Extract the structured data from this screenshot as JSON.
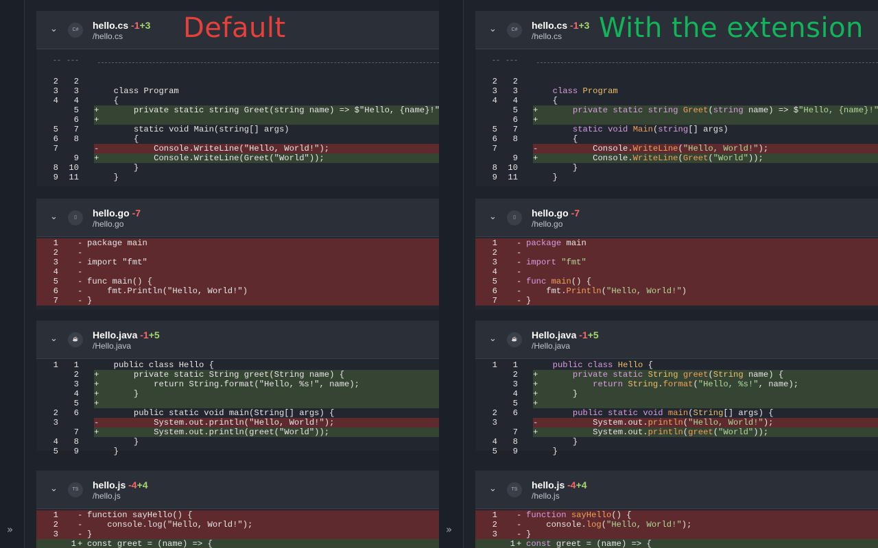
{
  "labels": {
    "left": "Default",
    "right": "With the extension",
    "left_color": "#e5413a",
    "right_color": "#12b35a"
  },
  "icons": {
    "expand": "»",
    "collapse": "⌄"
  },
  "files": [
    {
      "name": "hello.cs",
      "path": "/hello.cs",
      "removed": "-1",
      "added": "+3",
      "icon_text": "C#",
      "hunk_marks": [
        "--",
        "---"
      ],
      "rows": [
        {
          "t": "c",
          "o": "2",
          "n": "2",
          "code": ""
        },
        {
          "t": "c",
          "o": "3",
          "n": "3",
          "code": "  class Program"
        },
        {
          "t": "c",
          "o": "4",
          "n": "4",
          "code": "  {"
        },
        {
          "t": "a",
          "o": "",
          "n": "5",
          "code": "      private static string Greet(string name) => $\"Hello, {name}!\";"
        },
        {
          "t": "a",
          "o": "",
          "n": "6",
          "code": ""
        },
        {
          "t": "c",
          "o": "5",
          "n": "7",
          "code": "      static void Main(string[] args)"
        },
        {
          "t": "c",
          "o": "6",
          "n": "8",
          "code": "      {"
        },
        {
          "t": "d",
          "o": "7",
          "n": "",
          "code": "          Console.WriteLine(\"Hello, World!\");"
        },
        {
          "t": "a",
          "o": "",
          "n": "9",
          "code": "          Console.WriteLine(Greet(\"World\"));"
        },
        {
          "t": "c",
          "o": "8",
          "n": "10",
          "code": "      }"
        },
        {
          "t": "c",
          "o": "9",
          "n": "11",
          "code": "  }"
        }
      ]
    },
    {
      "name": "hello.go",
      "path": "/hello.go",
      "removed": "-7",
      "added": "",
      "icon_text": "▯",
      "rows": [
        {
          "t": "d",
          "o": "1",
          "n": "",
          "code": "package main"
        },
        {
          "t": "d",
          "o": "2",
          "n": "",
          "code": ""
        },
        {
          "t": "d",
          "o": "3",
          "n": "",
          "code": "import \"fmt\""
        },
        {
          "t": "d",
          "o": "4",
          "n": "",
          "code": ""
        },
        {
          "t": "d",
          "o": "5",
          "n": "",
          "code": "func main() {"
        },
        {
          "t": "d",
          "o": "6",
          "n": "",
          "code": "    fmt.Println(\"Hello, World!\")"
        },
        {
          "t": "d",
          "o": "7",
          "n": "",
          "code": "}"
        }
      ]
    },
    {
      "name": "Hello.java",
      "path": "/Hello.java",
      "removed": "-1",
      "added": "+5",
      "icon_text": "☕",
      "rows": [
        {
          "t": "c",
          "o": "1",
          "n": "1",
          "code": "  public class Hello {"
        },
        {
          "t": "a",
          "o": "",
          "n": "2",
          "code": "      private static String greet(String name) {"
        },
        {
          "t": "a",
          "o": "",
          "n": "3",
          "code": "          return String.format(\"Hello, %s!\", name);"
        },
        {
          "t": "a",
          "o": "",
          "n": "4",
          "code": "      }"
        },
        {
          "t": "a",
          "o": "",
          "n": "5",
          "code": ""
        },
        {
          "t": "c",
          "o": "2",
          "n": "6",
          "code": "      public static void main(String[] args) {"
        },
        {
          "t": "d",
          "o": "3",
          "n": "",
          "code": "          System.out.println(\"Hello, World!\");"
        },
        {
          "t": "a",
          "o": "",
          "n": "7",
          "code": "          System.out.println(greet(\"World\"));"
        },
        {
          "t": "c",
          "o": "4",
          "n": "8",
          "code": "      }"
        },
        {
          "t": "c",
          "o": "5",
          "n": "9",
          "code": "  }"
        }
      ]
    },
    {
      "name": "hello.js",
      "path": "/hello.js",
      "removed": "-4",
      "added": "+4",
      "icon_text": "TS",
      "rows": [
        {
          "t": "d",
          "o": "1",
          "n": "",
          "code": "function sayHello() {"
        },
        {
          "t": "d",
          "o": "2",
          "n": "",
          "code": "    console.log(\"Hello, World!\");"
        },
        {
          "t": "d",
          "o": "3",
          "n": "",
          "code": "}"
        },
        {
          "t": "a",
          "o": "",
          "n": "1",
          "code": "const greet = (name) => {"
        }
      ]
    }
  ]
}
